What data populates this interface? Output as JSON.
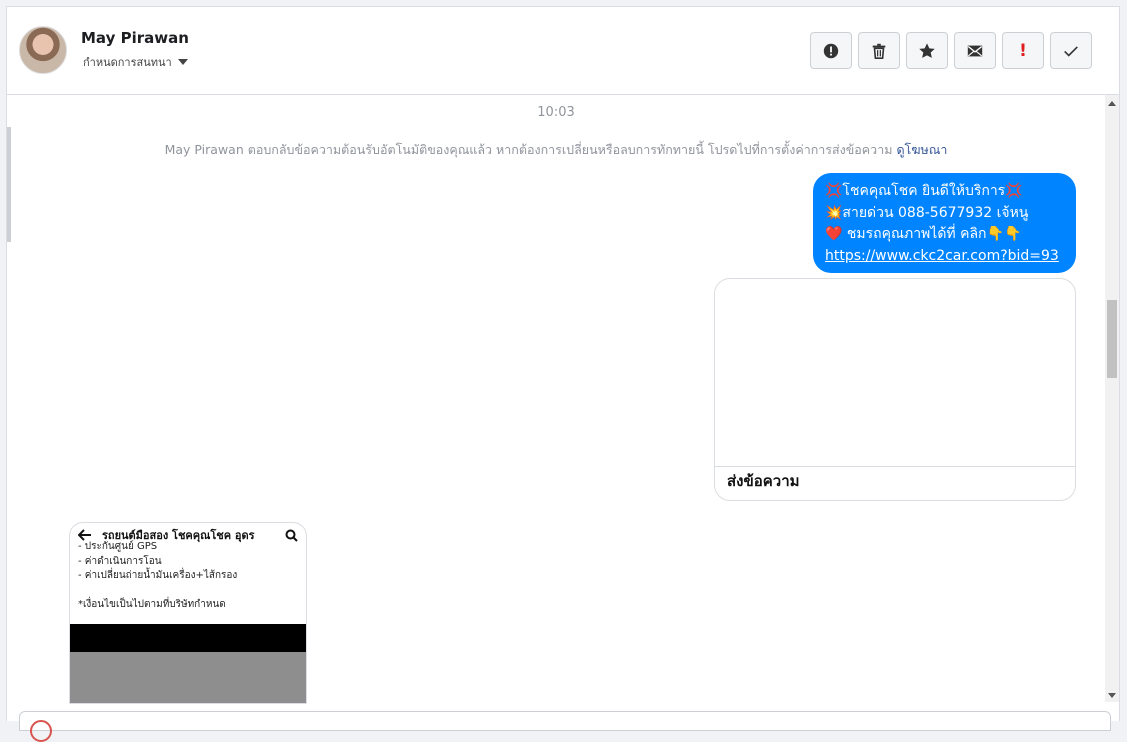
{
  "header": {
    "name": "May Pirawan",
    "subtitle": "กำหนดการสนทนา"
  },
  "actions": [
    {
      "icon": "alert-icon",
      "label": "!"
    },
    {
      "icon": "trash-icon",
      "label": ""
    },
    {
      "icon": "star-icon",
      "label": ""
    },
    {
      "icon": "mail-icon",
      "label": ""
    },
    {
      "icon": "spam-icon",
      "label": "!"
    },
    {
      "icon": "check-icon",
      "label": ""
    }
  ],
  "thread": {
    "time": "10:03",
    "notice_text": "May Pirawan ตอบกลับข้อความต้อนรับอัตโนมัติของคุณแล้ว หากต้องการเปลี่ยนหรือลบการทักทายนี้ โปรดไปที่การตั้งค่าการส่งข้อความ",
    "notice_link": "ดูโฆษณา",
    "bubble_lines": [
      "💢โชคคุณโชค ยินดีให้บริการ💢",
      "💥สายด่วน 088-5677932 เจ้หนู",
      "❤️ ชมรถคุณภาพได้ที่   คลิก👇👇"
    ],
    "bubble_link": "https://www.ckc2car.com?bid=93",
    "card_cta": "ส่งข้อความ",
    "shot_title": "รถยนต์มือสอง โชคคุณโชค อุดร",
    "shot_lines": [
      "- ประกันศูนย์ GPS",
      "- ค่าดำเนินการโอน",
      "- ค่าเปลี่ยนถ่ายน้ำมันเครื่อง+ไส้กรอง",
      "",
      "*เงื่อนไขเป็นไปตามที่บริษัทกำหนด"
    ]
  },
  "colors": {
    "bubble": "#0084ff",
    "link": "#385898",
    "spam": "#e02020"
  }
}
